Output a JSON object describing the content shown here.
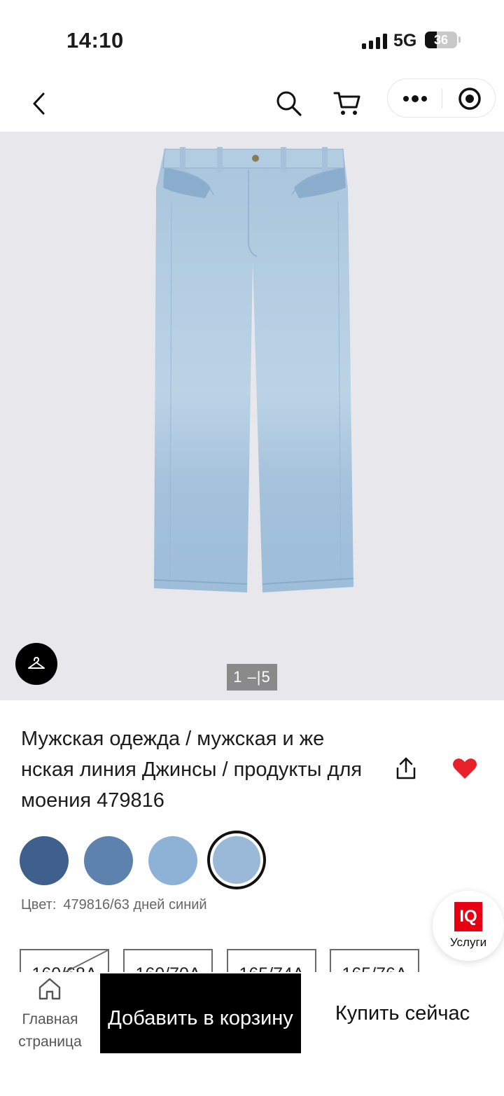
{
  "status_bar": {
    "time": "14:10",
    "network": "5G",
    "battery_level": "36",
    "battery_fraction": 0.36
  },
  "nav": {
    "back_icon": "chevron-left-icon",
    "search_icon": "search-icon",
    "cart_icon": "cart-icon",
    "more_icon": "more-dots-icon",
    "target_icon": "target-icon"
  },
  "gallery": {
    "counter": "1 –|5",
    "background_color": "#e8e7ec",
    "denim_color": "#a6c4dc"
  },
  "product": {
    "title": "Мужская одежда / мужская и же нская линия Джинсы / продукты для моения 479816",
    "color_label": "Цвет:",
    "color_value": "479816/63 дней синий",
    "favorite_color": "#e8202a",
    "swatches": [
      {
        "color": "#3f5f8c"
      },
      {
        "color": "#5c82ad"
      },
      {
        "color": "#8eb1d6"
      },
      {
        "color": "#9ab9d8",
        "selected": true
      }
    ],
    "sizes": [
      {
        "label": "160/68A",
        "unavailable": true
      },
      {
        "label": "160/70A"
      },
      {
        "label": "165/74A"
      },
      {
        "label": "165/76A"
      }
    ]
  },
  "service_badge": {
    "logo": "IQ",
    "label": "Услуги",
    "brand_color": "#e60012"
  },
  "bottom_bar": {
    "home_label": "Главная страница",
    "add_to_cart": "Добавить в корзину",
    "buy_now": "Купить сейчас"
  }
}
